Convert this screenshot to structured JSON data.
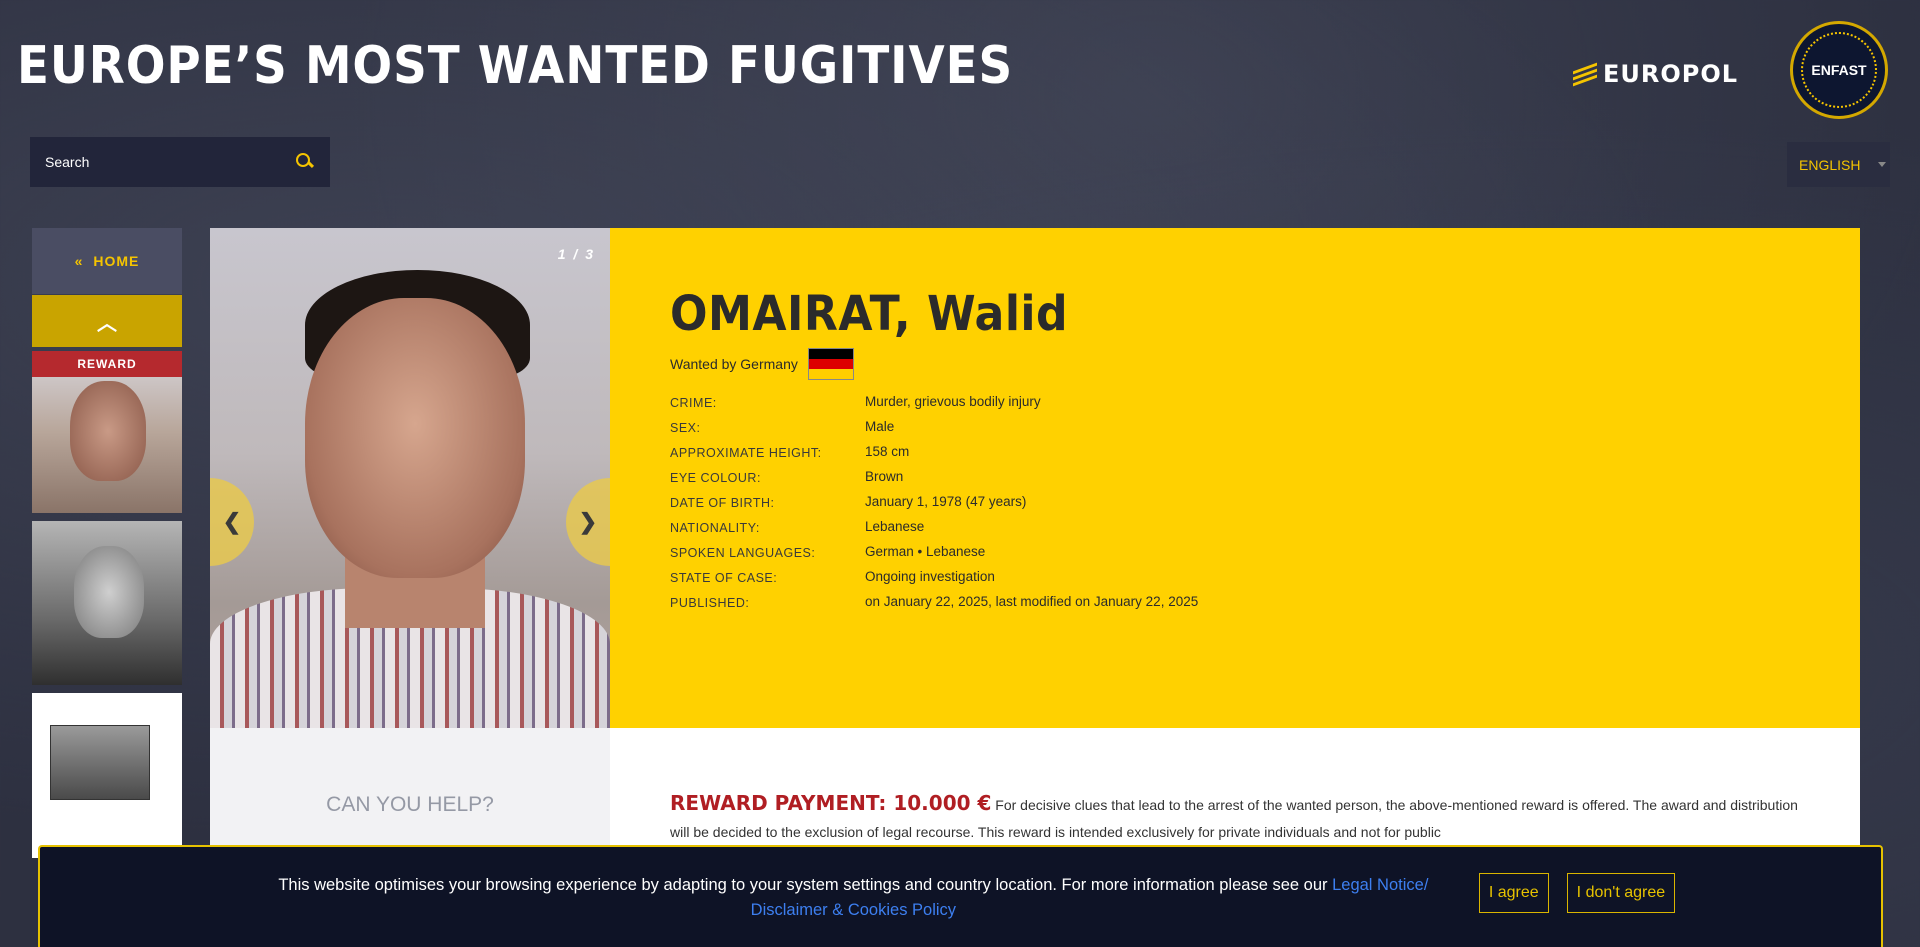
{
  "header": {
    "title": "EUROPE’S MOST WANTED FUGITIVES",
    "europol_logo": "EUROPOL",
    "enfast_logo": "ENFAST"
  },
  "search": {
    "placeholder": "Search",
    "icon": "search-icon"
  },
  "language": {
    "selected": "ENGLISH"
  },
  "sidebar": {
    "home_label": "HOME",
    "home_icon": "«",
    "up_icon": "︿",
    "reward_tag": "REWARD"
  },
  "fugitive": {
    "image_counter": "1 / 3",
    "name": "OMAIRAT, Walid",
    "wanted_by": "Wanted by Germany",
    "flag_colors": [
      "#000000",
      "#dd0000",
      "#ffce00"
    ],
    "details": [
      {
        "label": "CRIME:",
        "value": "Murder, grievous bodily injury"
      },
      {
        "label": "SEX:",
        "value": "Male"
      },
      {
        "label": "APPROXIMATE HEIGHT:",
        "value": "158 cm"
      },
      {
        "label": "EYE COLOUR:",
        "value": "Brown"
      },
      {
        "label": "DATE OF BIRTH:",
        "value": "January 1, 1978 (47 years)"
      },
      {
        "label": "NATIONALITY:",
        "value": "Lebanese"
      },
      {
        "label": "SPOKEN LANGUAGES:",
        "value": "German • Lebanese"
      },
      {
        "label": "STATE OF CASE:",
        "value": "Ongoing investigation"
      },
      {
        "label": "PUBLISHED:",
        "value": "on January 22, 2025, last modified on January 22, 2025"
      }
    ]
  },
  "carousel": {
    "prev": "❮",
    "next": "❯"
  },
  "help": {
    "title": "CAN YOU HELP?"
  },
  "reward": {
    "title": "REWARD PAYMENT: 10.000 €",
    "text": "For decisive clues that lead to the arrest of the wanted person, the above-mentioned reward is offered. The award and distribution will be decided to the exclusion of legal recourse. This reward is intended exclusively for private individuals and not for public"
  },
  "cookie": {
    "text": "This website optimises your browsing experience by adapting to your system settings and country location. For more information please see our ",
    "link": "Legal Notice/ Disclaimer & Cookies Policy",
    "agree": "I agree",
    "disagree": "I don't agree"
  },
  "colors": {
    "accent": "#ffd100",
    "reward_red": "#b01e23",
    "bg": "#2d3040",
    "cookie_bg": "#0e1326"
  }
}
